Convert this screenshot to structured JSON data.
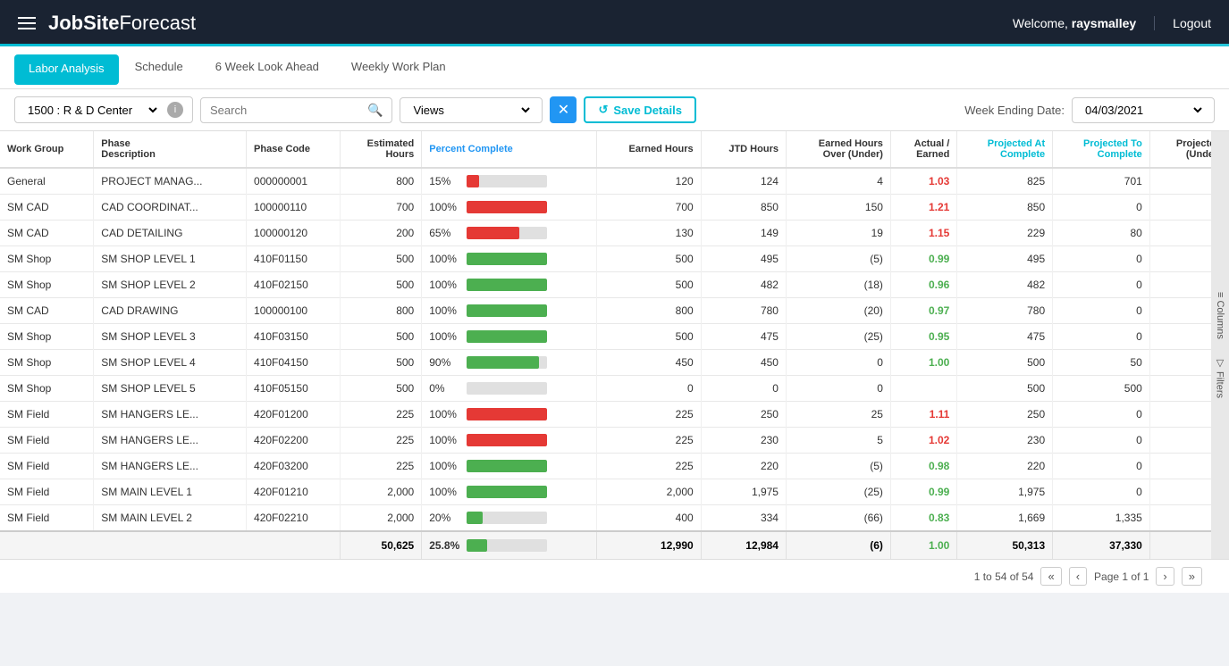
{
  "header": {
    "hamburger_label": "menu",
    "logo_bold": "JobSite",
    "logo_light": "Forecast",
    "welcome_text": "Welcome, ",
    "username": "raysmalley",
    "logout_label": "Logout"
  },
  "tabs": [
    {
      "id": "labor-analysis",
      "label": "Labor Analysis",
      "active": true
    },
    {
      "id": "schedule",
      "label": "Schedule",
      "active": false
    },
    {
      "id": "6-week",
      "label": "6 Week Look Ahead",
      "active": false
    },
    {
      "id": "weekly",
      "label": "Weekly Work Plan",
      "active": false
    }
  ],
  "toolbar": {
    "project_value": "1500 : R & D Center",
    "search_placeholder": "Search",
    "views_placeholder": "Views",
    "clear_icon": "✕",
    "save_label": "Save Details",
    "save_icon": "↺",
    "week_ending_label": "Week Ending Date:",
    "date_value": "04/03/2021"
  },
  "side_controls": {
    "columns_label": "Columns",
    "filters_label": "Filters"
  },
  "table": {
    "columns": [
      {
        "id": "work-group",
        "label": "Work Group",
        "color": "normal"
      },
      {
        "id": "phase-desc",
        "label": "Phase Description",
        "color": "normal"
      },
      {
        "id": "phase-code",
        "label": "Phase Code",
        "color": "normal"
      },
      {
        "id": "est-hours",
        "label": "Estimated Hours",
        "color": "normal"
      },
      {
        "id": "pct-complete",
        "label": "Percent Complete",
        "color": "blue"
      },
      {
        "id": "earned-hours",
        "label": "Earned Hours",
        "color": "normal"
      },
      {
        "id": "jtd-hours",
        "label": "JTD Hours",
        "color": "normal"
      },
      {
        "id": "earned-over-under",
        "label": "Earned Hours Over (Under)",
        "color": "normal"
      },
      {
        "id": "actual-earned",
        "label": "Actual / Earned",
        "color": "normal"
      },
      {
        "id": "proj-at-complete",
        "label": "Projected At Complete",
        "color": "cyan"
      },
      {
        "id": "proj-to-complete",
        "label": "Projected To Complete",
        "color": "cyan"
      },
      {
        "id": "projected-under",
        "label": "Projected (Under)",
        "color": "normal"
      }
    ],
    "rows": [
      {
        "work_group": "General",
        "phase_desc": "PROJECT MANAG...",
        "phase_code": "000000001",
        "est_hours": "800",
        "pct_label": "15%",
        "pct_value": 15,
        "bar_color": "red",
        "earned_hours": "120",
        "jtd_hours": "124",
        "earned_over_under": "4",
        "actual_earned": "1.03",
        "actual_color": "red",
        "proj_at": "825",
        "proj_to": "701",
        "proj_under": ""
      },
      {
        "work_group": "SM CAD",
        "phase_desc": "CAD COORDINAT...",
        "phase_code": "100000110",
        "est_hours": "700",
        "pct_label": "100%",
        "pct_value": 100,
        "bar_color": "red",
        "earned_hours": "700",
        "jtd_hours": "850",
        "earned_over_under": "150",
        "actual_earned": "1.21",
        "actual_color": "red",
        "proj_at": "850",
        "proj_to": "0",
        "proj_under": ""
      },
      {
        "work_group": "SM CAD",
        "phase_desc": "CAD DETAILING",
        "phase_code": "100000120",
        "est_hours": "200",
        "pct_label": "65%",
        "pct_value": 65,
        "bar_color": "red",
        "earned_hours": "130",
        "jtd_hours": "149",
        "earned_over_under": "19",
        "actual_earned": "1.15",
        "actual_color": "red",
        "proj_at": "229",
        "proj_to": "80",
        "proj_under": ""
      },
      {
        "work_group": "SM Shop",
        "phase_desc": "SM SHOP LEVEL 1",
        "phase_code": "410F01150",
        "est_hours": "500",
        "pct_label": "100%",
        "pct_value": 100,
        "bar_color": "green",
        "earned_hours": "500",
        "jtd_hours": "495",
        "earned_over_under": "(5)",
        "actual_earned": "0.99",
        "actual_color": "green",
        "proj_at": "495",
        "proj_to": "0",
        "proj_under": ""
      },
      {
        "work_group": "SM Shop",
        "phase_desc": "SM SHOP LEVEL 2",
        "phase_code": "410F02150",
        "est_hours": "500",
        "pct_label": "100%",
        "pct_value": 100,
        "bar_color": "green",
        "earned_hours": "500",
        "jtd_hours": "482",
        "earned_over_under": "(18)",
        "actual_earned": "0.96",
        "actual_color": "green",
        "proj_at": "482",
        "proj_to": "0",
        "proj_under": ""
      },
      {
        "work_group": "SM CAD",
        "phase_desc": "CAD DRAWING",
        "phase_code": "100000100",
        "est_hours": "800",
        "pct_label": "100%",
        "pct_value": 100,
        "bar_color": "green",
        "earned_hours": "800",
        "jtd_hours": "780",
        "earned_over_under": "(20)",
        "actual_earned": "0.97",
        "actual_color": "green",
        "proj_at": "780",
        "proj_to": "0",
        "proj_under": ""
      },
      {
        "work_group": "SM Shop",
        "phase_desc": "SM SHOP LEVEL 3",
        "phase_code": "410F03150",
        "est_hours": "500",
        "pct_label": "100%",
        "pct_value": 100,
        "bar_color": "green",
        "earned_hours": "500",
        "jtd_hours": "475",
        "earned_over_under": "(25)",
        "actual_earned": "0.95",
        "actual_color": "green",
        "proj_at": "475",
        "proj_to": "0",
        "proj_under": ""
      },
      {
        "work_group": "SM Shop",
        "phase_desc": "SM SHOP LEVEL 4",
        "phase_code": "410F04150",
        "est_hours": "500",
        "pct_label": "90%",
        "pct_value": 90,
        "bar_color": "green",
        "earned_hours": "450",
        "jtd_hours": "450",
        "earned_over_under": "0",
        "actual_earned": "1.00",
        "actual_color": "green",
        "proj_at": "500",
        "proj_to": "50",
        "proj_under": ""
      },
      {
        "work_group": "SM Shop",
        "phase_desc": "SM SHOP LEVEL 5",
        "phase_code": "410F05150",
        "est_hours": "500",
        "pct_label": "0%",
        "pct_value": 0,
        "bar_color": "green",
        "earned_hours": "0",
        "jtd_hours": "0",
        "earned_over_under": "0",
        "actual_earned": "",
        "actual_color": "none",
        "proj_at": "500",
        "proj_to": "500",
        "proj_under": ""
      },
      {
        "work_group": "SM Field",
        "phase_desc": "SM HANGERS LE...",
        "phase_code": "420F01200",
        "est_hours": "225",
        "pct_label": "100%",
        "pct_value": 100,
        "bar_color": "red",
        "earned_hours": "225",
        "jtd_hours": "250",
        "earned_over_under": "25",
        "actual_earned": "1.11",
        "actual_color": "red",
        "proj_at": "250",
        "proj_to": "0",
        "proj_under": ""
      },
      {
        "work_group": "SM Field",
        "phase_desc": "SM HANGERS LE...",
        "phase_code": "420F02200",
        "est_hours": "225",
        "pct_label": "100%",
        "pct_value": 100,
        "bar_color": "red",
        "earned_hours": "225",
        "jtd_hours": "230",
        "earned_over_under": "5",
        "actual_earned": "1.02",
        "actual_color": "red",
        "proj_at": "230",
        "proj_to": "0",
        "proj_under": ""
      },
      {
        "work_group": "SM Field",
        "phase_desc": "SM HANGERS LE...",
        "phase_code": "420F03200",
        "est_hours": "225",
        "pct_label": "100%",
        "pct_value": 100,
        "bar_color": "green",
        "earned_hours": "225",
        "jtd_hours": "220",
        "earned_over_under": "(5)",
        "actual_earned": "0.98",
        "actual_color": "green",
        "proj_at": "220",
        "proj_to": "0",
        "proj_under": ""
      },
      {
        "work_group": "SM Field",
        "phase_desc": "SM MAIN LEVEL 1",
        "phase_code": "420F01210",
        "est_hours": "2,000",
        "pct_label": "100%",
        "pct_value": 100,
        "bar_color": "green",
        "earned_hours": "2,000",
        "jtd_hours": "1,975",
        "earned_over_under": "(25)",
        "actual_earned": "0.99",
        "actual_color": "green",
        "proj_at": "1,975",
        "proj_to": "0",
        "proj_under": ""
      },
      {
        "work_group": "SM Field",
        "phase_desc": "SM MAIN LEVEL 2",
        "phase_code": "420F02210",
        "est_hours": "2,000",
        "pct_label": "20%",
        "pct_value": 20,
        "bar_color": "green",
        "earned_hours": "400",
        "jtd_hours": "334",
        "earned_over_under": "(66)",
        "actual_earned": "0.83",
        "actual_color": "green",
        "proj_at": "1,669",
        "proj_to": "1,335",
        "proj_under": ""
      }
    ],
    "footer": {
      "est_hours": "50,625",
      "pct_label": "25.8%",
      "pct_value": 25.8,
      "earned_hours": "12,990",
      "jtd_hours": "12,984",
      "earned_over_under": "(6)",
      "actual_earned": "1.00",
      "proj_at": "50,313",
      "proj_to": "37,330"
    }
  },
  "pagination": {
    "range_text": "1 to 54 of 54",
    "page_text": "Page 1 of 1"
  }
}
